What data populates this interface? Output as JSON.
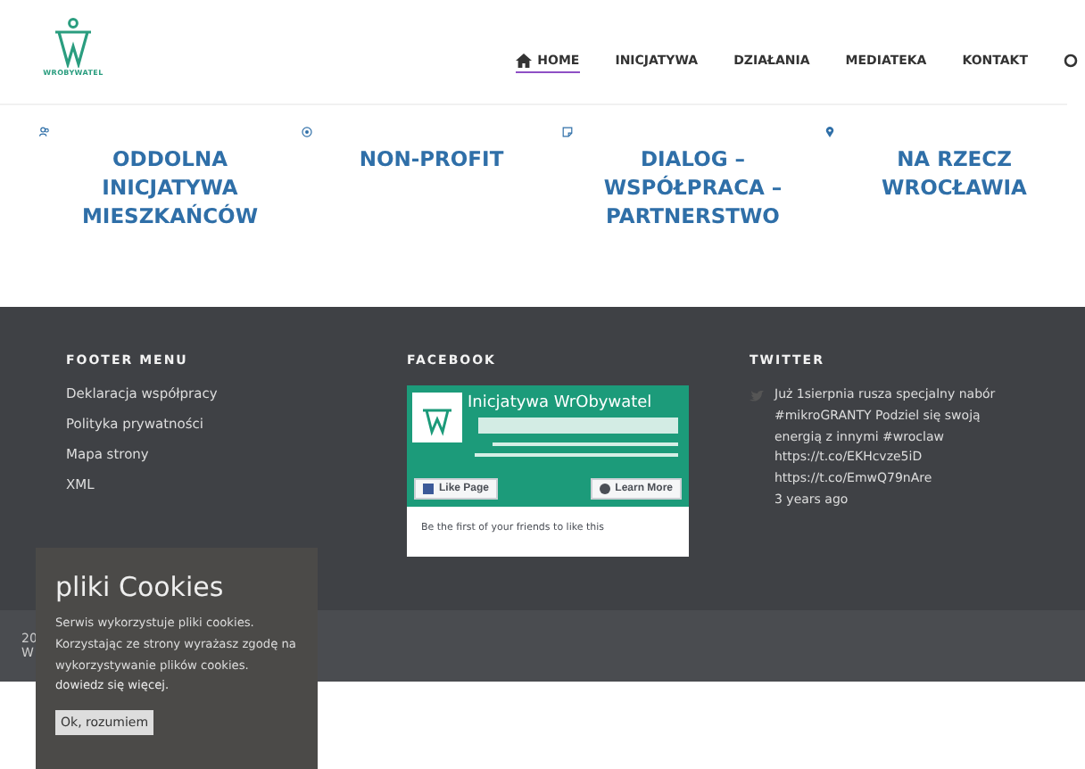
{
  "header": {
    "logo_text": "WROBYWATEL",
    "nav": [
      {
        "label": "HOME",
        "selected": true,
        "kind": "home"
      },
      {
        "label": "INICJATYWA",
        "selected": false,
        "kind": "link"
      },
      {
        "label": "DZIAŁANIA",
        "selected": false,
        "kind": "link"
      },
      {
        "label": "MEDIATEKA",
        "selected": false,
        "kind": "link"
      },
      {
        "label": "KONTAKT",
        "selected": false,
        "kind": "link"
      },
      {
        "selected": false,
        "kind": "search"
      }
    ]
  },
  "features": [
    {
      "kind": "people",
      "title": "ODDOLNA INICJATYWA MIESZKAŃCÓW"
    },
    {
      "kind": "coin",
      "title": "NON-PROFIT"
    },
    {
      "kind": "note",
      "title": "DIALOG – WSPÓŁPRACA – PARTNERSTWO"
    },
    {
      "kind": "pin",
      "title": "NA RZECZ WROCŁAWIA"
    }
  ],
  "footer": {
    "menu": {
      "heading": "FOOTER MENU",
      "links": [
        "Deklaracja współpracy",
        "Polityka prywatności",
        "Mapa strony",
        "XML"
      ]
    },
    "facebook": {
      "heading": "FACEBOOK",
      "page_title": "Inicjatywa WrObywatel",
      "like_button": "Like Page",
      "learn_button": "Learn More",
      "friends_text": "Be the first of your friends to like this"
    },
    "twitter": {
      "heading": "TWITTER",
      "tweet_lines": [
        "Już 1sierpnia rusza specjalny nabór",
        "#mikroGRANTY Podziel się swoją",
        "energią z innymi #wroclaw",
        "https://t.co/EKHcvze5iD",
        "https://t.co/EmwQ79nAre"
      ],
      "time": "3 years ago"
    }
  },
  "bottom_bar": {
    "lines": [
      "20",
      "W"
    ]
  },
  "cookies": {
    "title": "pliki Cookies",
    "text": "Serwis wykorzystuje pliki cookies. Korzystając ze strony wyrażasz zgodę na wykorzystywanie plików cookies.",
    "link": "dowiedz się więcej.",
    "button": "Ok, rozumiem"
  }
}
